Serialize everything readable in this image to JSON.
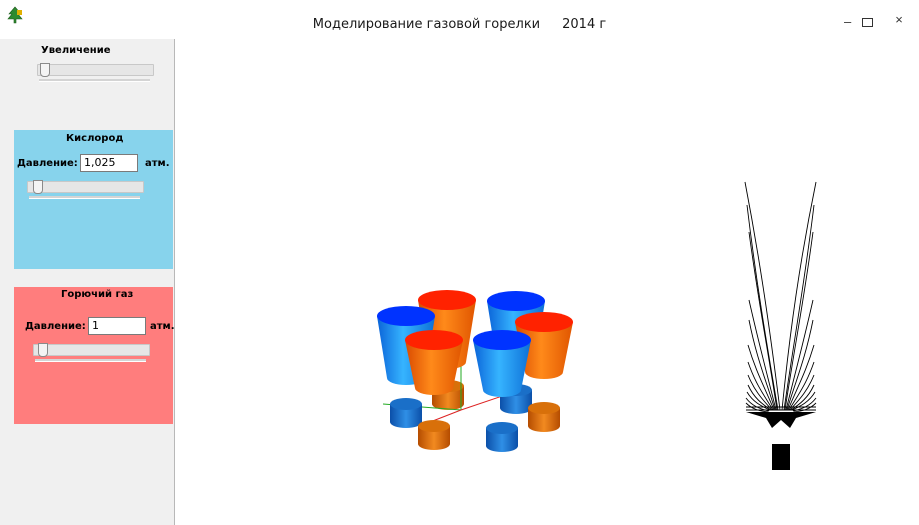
{
  "window": {
    "title": "Моделирование газовой горелки",
    "year": "2014 г",
    "minimize_glyph": "–",
    "close_glyph": "×",
    "app_icon": "app-tree-icon"
  },
  "sidebar": {
    "zoom": {
      "label": "Увеличение",
      "slider_value": 0.03
    },
    "oxygen": {
      "title": "Кислород",
      "pressure_label": "Давление:",
      "pressure_value": "1,025",
      "unit": "атм.",
      "slider_value": 0.05,
      "color": "#87d3ec"
    },
    "fuel": {
      "title": "Горючий газ",
      "pressure_label": "Давление:",
      "pressure_value": "1",
      "unit": "атм.",
      "slider_value": 0.03,
      "color": "#ff7d7d"
    }
  },
  "scene": {
    "blue_cone_color": "#1a8fff",
    "orange_cone_color": "#ff6a00",
    "red_cap_color": "#ff2200",
    "blue_cap_color": "#0033ff"
  }
}
